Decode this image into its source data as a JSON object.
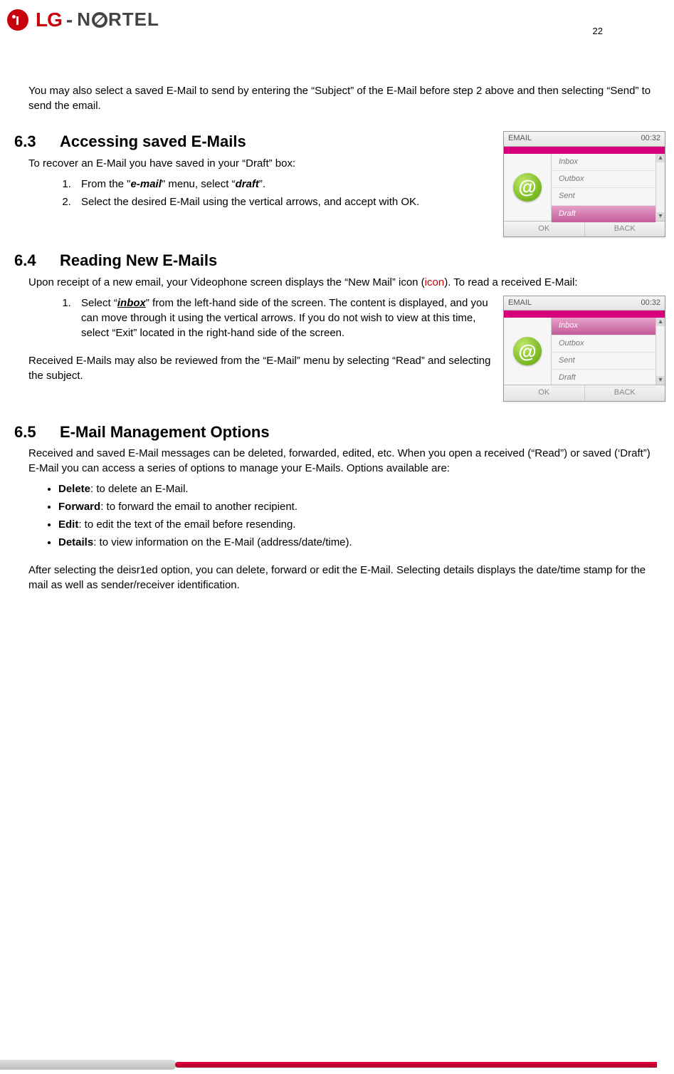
{
  "page_number": "22",
  "logo": {
    "lg_text": "LG",
    "nortel_pre": "N",
    "nortel_post": "RTEL"
  },
  "intro_paragraph": "You may also select a saved E-Mail to send by entering the “Subject” of the E-Mail before step 2 above and then selecting “Send” to send the email.",
  "section_63": {
    "num": "6.3",
    "title": "Accessing saved E-Mails",
    "para": "To recover an E-Mail you have saved in your “Draft” box:",
    "steps": {
      "s1_pre": "From the \"",
      "s1_em": "e-mail",
      "s1_mid": "\" menu, select “",
      "s1_em2": "draft",
      "s1_post": "”.",
      "s2": "Select the desired E-Mail using the vertical arrows, and accept with OK."
    }
  },
  "section_64": {
    "num": "6.4",
    "title": "Reading New E-Mails",
    "para_pre": "Upon receipt of a new email, your Videophone screen displays the “New Mail” icon (",
    "para_icon": "icon",
    "para_post": ").  To read a received E-Mail:",
    "steps": {
      "s1_pre": "Select “",
      "s1_em": "inbox",
      "s1_post": "” from the left-hand side of the screen.  The content is displayed, and you can move through it using the vertical arrows. If you do not wish to view at this time, select “Exit” located in the right-hand side of the screen."
    },
    "para2": "Received E-Mails may also be reviewed from the “E-Mail” menu by selecting “Read” and selecting the subject."
  },
  "section_65": {
    "num": "6.5",
    "title": "E-Mail Management Options",
    "para": "Received and saved E-Mail messages can be deleted, forwarded, edited, etc.  When you open a received (“Read”) or saved (‘Draft”) E-Mail you can access a series of options to manage your E-Mails.  Options available are:",
    "bullets": {
      "b1_t": "Delete",
      "b1_d": ": to delete an E-Mail.",
      "b2_t": "Forward",
      "b2_d": ": to forward the email to another recipient.",
      "b3_t": "Edit",
      "b3_d": ": to edit the text of the email before resending.",
      "b4_t": "Details",
      "b4_d": ": to view information on the E-Mail (address/date/time)."
    },
    "para2": "After selecting the deisr1ed option, you can delete, forward or edit the E-Mail.  Selecting details displays the date/time stamp for the mail as well as sender/receiver identification."
  },
  "figure1": {
    "header_title": "EMAIL",
    "header_time": "00:32",
    "items": [
      "Inbox",
      "Outbox",
      "Sent",
      "Draft"
    ],
    "selected": "Draft",
    "btn_ok": "OK",
    "btn_back": "BACK",
    "icon_glyph": "@"
  },
  "figure2": {
    "header_title": "EMAIL",
    "header_time": "00:32",
    "items": [
      "Inbox",
      "Outbox",
      "Sent",
      "Draft"
    ],
    "selected": "Inbox",
    "btn_ok": "OK",
    "btn_back": "BACK",
    "icon_glyph": "@"
  }
}
